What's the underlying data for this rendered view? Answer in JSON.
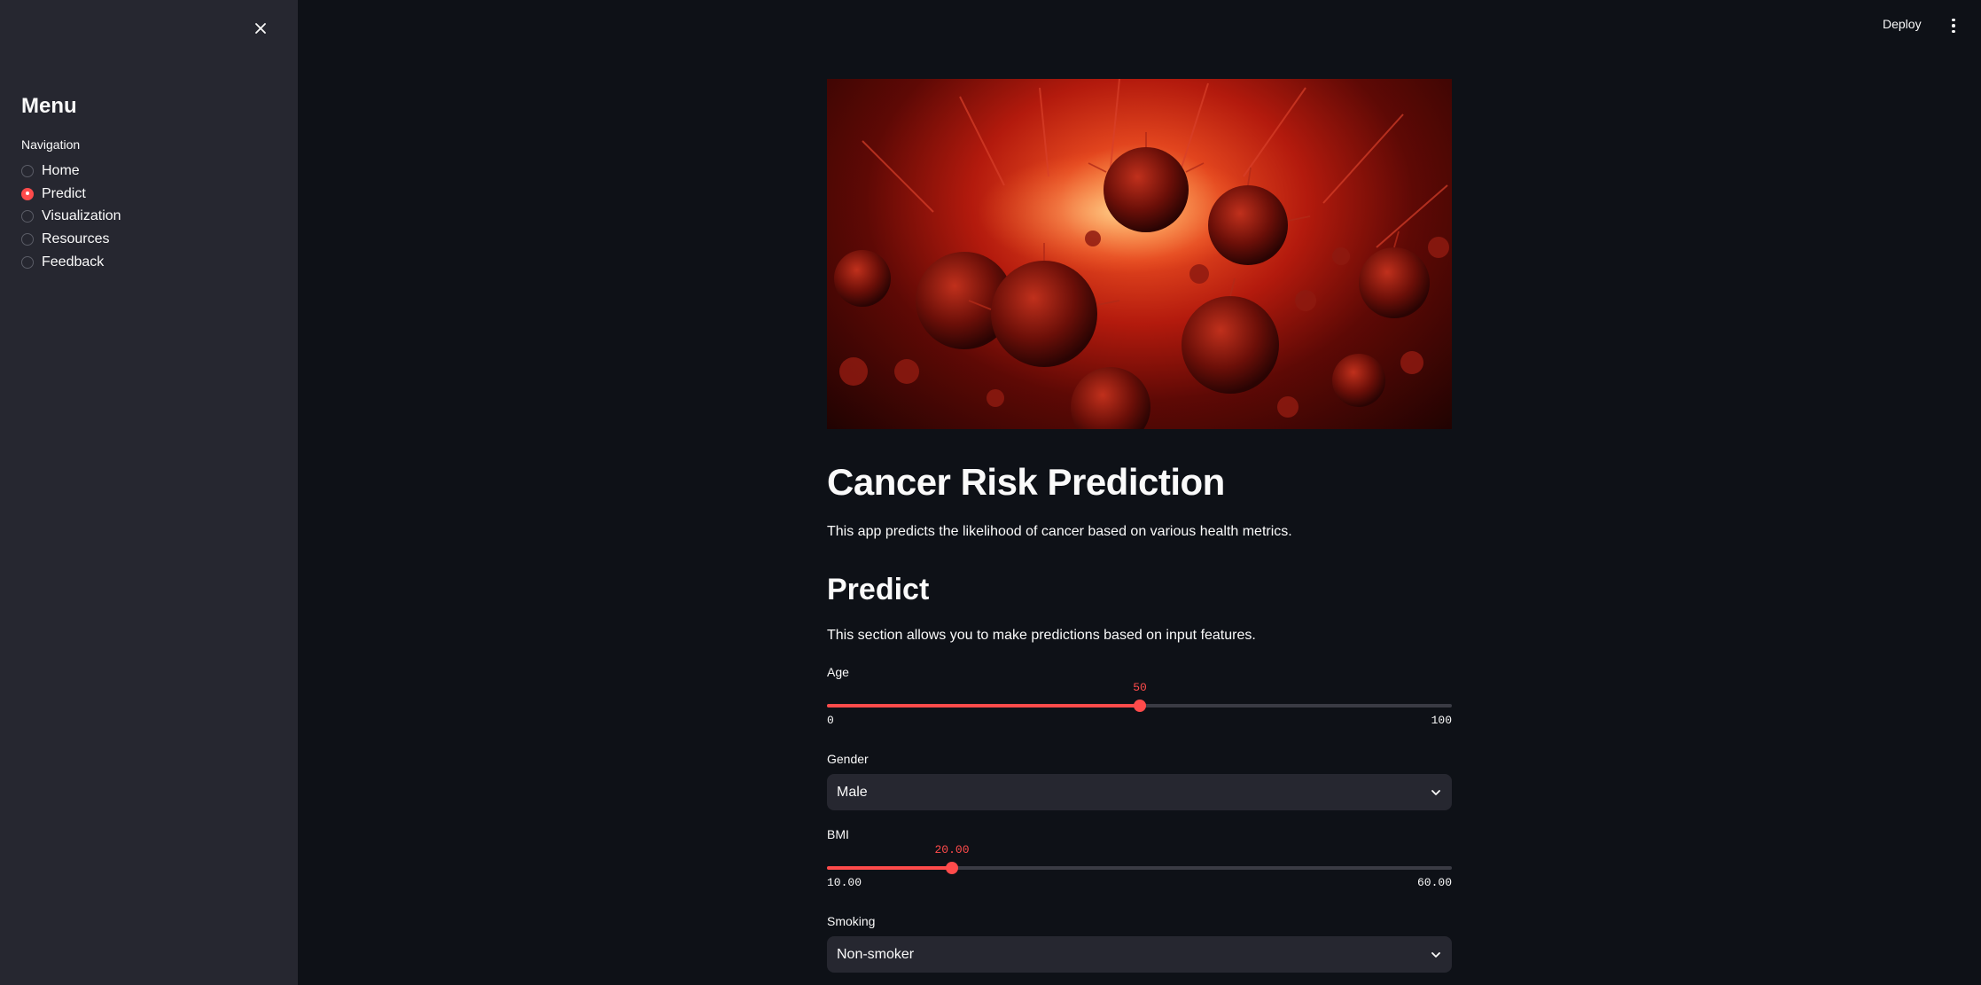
{
  "sidebar": {
    "title": "Menu",
    "nav_label": "Navigation",
    "items": [
      {
        "label": "Home",
        "selected": false
      },
      {
        "label": "Predict",
        "selected": true
      },
      {
        "label": "Visualization",
        "selected": false
      },
      {
        "label": "Resources",
        "selected": false
      },
      {
        "label": "Feedback",
        "selected": false
      }
    ]
  },
  "header": {
    "deploy_label": "Deploy"
  },
  "main": {
    "hero_image_icon": "cancer-cells-illustration",
    "title": "Cancer Risk Prediction",
    "intro": "This app predicts the likelihood of cancer based on various health metrics.",
    "section_title": "Predict",
    "section_desc": "This section allows you to make predictions based on input features.",
    "age": {
      "label": "Age",
      "value": "50",
      "min": "0",
      "max": "100",
      "fraction": 0.5
    },
    "gender": {
      "label": "Gender",
      "value": "Male"
    },
    "bmi": {
      "label": "BMI",
      "value": "20.00",
      "min": "10.00",
      "max": "60.00",
      "fraction": 0.2
    },
    "smoking": {
      "label": "Smoking",
      "value": "Non-smoker"
    }
  },
  "colors": {
    "accent": "#ff4b4b",
    "background": "#0e1117",
    "sidebar": "#262730"
  }
}
